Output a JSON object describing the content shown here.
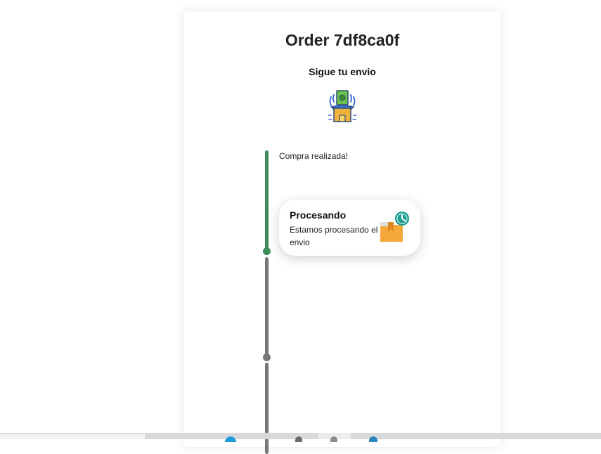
{
  "order": {
    "title": "Order 7df8ca0f",
    "subtitle": "Sigue tu envio",
    "hero_icon": "package-money-icon"
  },
  "timeline": {
    "steps": [
      {
        "label": "Compra realizada!",
        "status": "done",
        "color": "#3b8c5a"
      },
      {
        "label": "Procesando",
        "status": "current",
        "color": "#3b8c5a"
      },
      {
        "label": "",
        "status": "pending",
        "color": "#777777"
      }
    ],
    "current_card": {
      "title": "Procesando",
      "description": "Estamos procesando el envio",
      "icon": "box-clock-icon"
    }
  },
  "taskbar": {
    "icons": [
      "browser-icon",
      "app-icon",
      "app-icon",
      "app-icon"
    ]
  }
}
